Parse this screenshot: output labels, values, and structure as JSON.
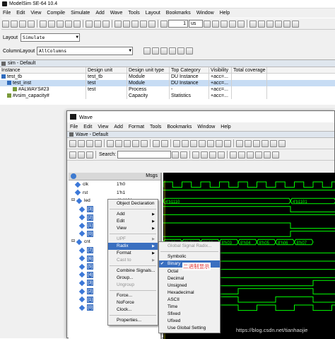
{
  "app": {
    "title": "ModelSim SE-64 10.4"
  },
  "menubar": [
    "File",
    "Edit",
    "View",
    "Compile",
    "Simulate",
    "Add",
    "Wave",
    "Tools",
    "Layout",
    "Bookmarks",
    "Window",
    "Help"
  ],
  "toolbar": {
    "run_value": "1",
    "run_unit": "us"
  },
  "layout_bar": {
    "label": "Layout",
    "value": "Simulate"
  },
  "column_bar": {
    "label": "ColumnLayout",
    "value": "AllColumns"
  },
  "sim_pane": {
    "title": "sim - Default",
    "columns": [
      "Instance",
      "Design unit",
      "Design unit type",
      "Top Category",
      "Visibility",
      "Total coverage"
    ],
    "rows": [
      {
        "name": "test_tb",
        "unit": "test_tb",
        "type": "Module",
        "cat": "DU Instance",
        "vis": "+acc=..."
      },
      {
        "name": "test_inst",
        "unit": "test",
        "type": "Module",
        "cat": "DU Instance",
        "vis": "+acc=..."
      },
      {
        "name": "#ALWAYS#23",
        "unit": "test",
        "type": "Process",
        "cat": "-",
        "vis": "+acc=..."
      },
      {
        "name": "#vsim_capacity#",
        "unit": "",
        "type": "Capacity",
        "cat": "Statistics",
        "vis": "+acc=..."
      }
    ]
  },
  "wave": {
    "title": "Wave",
    "menubar": [
      "File",
      "Edit",
      "View",
      "Add",
      "Format",
      "Tools",
      "Bookmarks",
      "Window",
      "Help"
    ],
    "pane_title": "Wave - Default",
    "search_label": "Search:",
    "msgs": "Msgs",
    "signals": [
      {
        "name": "clk",
        "value": "1'h0"
      },
      {
        "name": "rst",
        "value": "1'h1"
      },
      {
        "name": "led",
        "value": "4'b1101"
      },
      {
        "name": "[3]",
        "value": ""
      },
      {
        "name": "[2]",
        "value": ""
      },
      {
        "name": "[1]",
        "value": ""
      },
      {
        "name": "[0]",
        "value": ""
      },
      {
        "name": "cnt",
        "value": ""
      },
      {
        "name": "[7]",
        "value": ""
      },
      {
        "name": "[6]",
        "value": ""
      },
      {
        "name": "[5]",
        "value": ""
      },
      {
        "name": "[4]",
        "value": ""
      },
      {
        "name": "[3]",
        "value": ""
      },
      {
        "name": "[2]",
        "value": ""
      },
      {
        "name": "[1]",
        "value": ""
      },
      {
        "name": "[0]",
        "value": ""
      }
    ],
    "led_bus": [
      "4'b1110",
      "4'b1101"
    ],
    "cnt_bus": [
      "8'h00",
      "8'h01",
      "8'h02",
      "8'h03",
      "8'h04",
      "8'h05",
      "8'h06",
      "8'h07"
    ]
  },
  "context_menu": {
    "items": [
      "Object Declaration",
      "Add",
      "Edit",
      "View",
      "UPF",
      "Radix",
      "Format",
      "Cast to",
      "Combine Signals...",
      "Group...",
      "Ungroup",
      "Force...",
      "NoForce",
      "Clock...",
      "Properties..."
    ]
  },
  "radix_menu": {
    "header": "Global Signal Radix...",
    "items": [
      "Symbolic",
      "Binary",
      "Octal",
      "Decimal",
      "Unsigned",
      "Hexadecimal",
      "ASCII",
      "Time",
      "Sfixed",
      "Ufixed",
      "Use Global Setting"
    ],
    "annotation": "二进制显示"
  },
  "watermark": "https://blog.csdn.net/tianhaojie",
  "colors": {
    "wave_bg": "#000000",
    "wave_green": "#00ff00",
    "selection_blue": "#3a6fc0",
    "annotation_red": "#e03030"
  }
}
